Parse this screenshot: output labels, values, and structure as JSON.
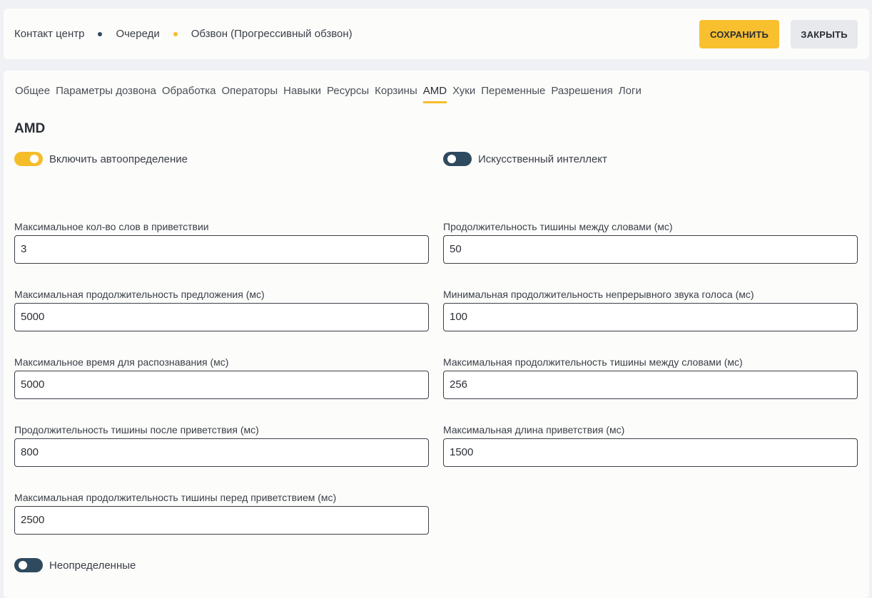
{
  "breadcrumb": {
    "items": [
      "Контакт центр",
      "Очереди",
      "Обзвон (Прогрессивный обзвон)"
    ]
  },
  "buttons": {
    "save": "СОХРАНИТЬ",
    "close": "ЗАКРЫТЬ"
  },
  "tabs": [
    "Общее",
    "Параметры дозвона",
    "Обработка",
    "Операторы",
    "Навыки",
    "Ресурсы",
    "Корзины",
    "AMD",
    "Хуки",
    "Переменные",
    "Разрешения",
    "Логи"
  ],
  "active_tab": "AMD",
  "section_title": "AMD",
  "toggles": {
    "auto_detect": {
      "label": "Включить автоопределение",
      "state": "on"
    },
    "ai": {
      "label": "Искусственный интеллект",
      "state": "off"
    },
    "undefined": {
      "label": "Неопределенные",
      "state": "off"
    }
  },
  "fields": {
    "max_words_greeting": {
      "label": "Максимальное кол-во слов в приветствии",
      "value": "3"
    },
    "silence_between_words": {
      "label": "Продолжительность тишины между словами (мс)",
      "value": "50"
    },
    "max_sentence_duration": {
      "label": "Максимальная продолжительность предложения (мс)",
      "value": "5000"
    },
    "min_voice_duration": {
      "label": "Минимальная продолжительность непрерывного звука голоса (мс)",
      "value": "100"
    },
    "max_recognition_time": {
      "label": "Максимальное время для распознавания (мс)",
      "value": "5000"
    },
    "max_silence_between_words": {
      "label": "Максимальная продолжительность тишины между словами (мс)",
      "value": "256"
    },
    "silence_after_greeting": {
      "label": "Продолжительность тишины после приветствия (мс)",
      "value": "800"
    },
    "max_greeting_length": {
      "label": "Максимальная длина приветствия (мс)",
      "value": "1500"
    },
    "max_silence_before_greeting": {
      "label": "Максимальная продолжительность тишины перед приветствием (мс)",
      "value": "2500"
    }
  },
  "colors": {
    "accent": "#f6bd2a",
    "toggle_off": "#2f4a5e",
    "background": "#f0f1f4",
    "panel": "#fcfcfb"
  }
}
